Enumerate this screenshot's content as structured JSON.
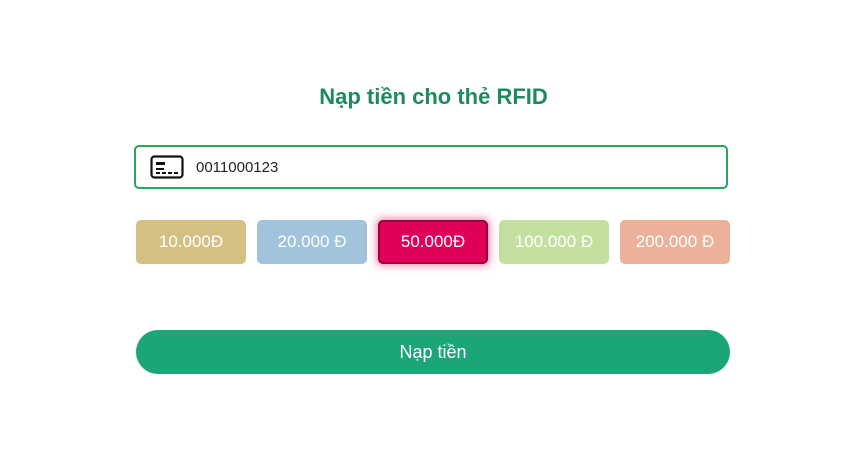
{
  "form": {
    "title": "Nạp tiền cho thẻ RFID",
    "card_icon": "credit-card-icon",
    "card_number": "0011000123"
  },
  "amounts": [
    {
      "label": "10.000Đ",
      "color": "#d4c084",
      "selected": false
    },
    {
      "label": "20.000 Đ",
      "color": "#a1c3dc",
      "selected": false
    },
    {
      "label": "50.000Đ",
      "color": "#e0005a",
      "selected": true
    },
    {
      "label": "100.000 Đ",
      "color": "#c4e0a0",
      "selected": false
    },
    {
      "label": "200.000 Đ",
      "color": "#ebb19b",
      "selected": false
    }
  ],
  "submit": {
    "label": "Nạp tiền",
    "color": "#1ca677"
  },
  "colors": {
    "title": "#1f8a5e",
    "field_border": "#27a55a"
  }
}
